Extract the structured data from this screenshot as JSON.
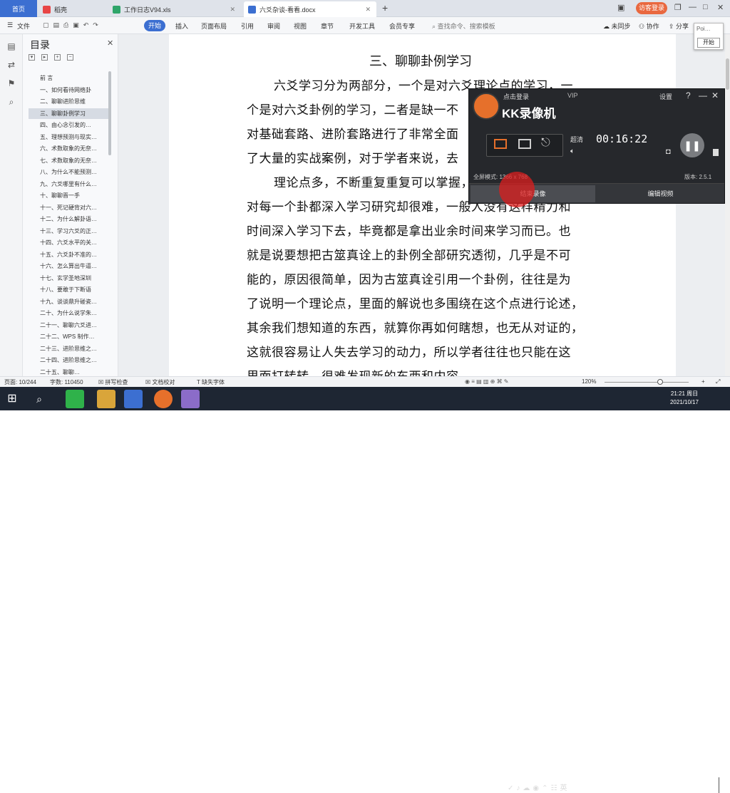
{
  "tabs": {
    "home": "首页",
    "t1": "稻壳",
    "t2": "工作日志V94.xls",
    "t3": "六爻杂谈-看看.docx"
  },
  "login": "访客登录",
  "toolbar": {
    "file": "文件",
    "start": "开始",
    "insert": "插入",
    "layout": "页面布局",
    "ref": "引用",
    "review": "审阅",
    "view": "视图",
    "chapter": "章节",
    "dev": "开发工具",
    "member": "会员专享",
    "search": "查找命令、搜索模板",
    "sync": "未同步",
    "collab": "协作",
    "share": "分享"
  },
  "toc": {
    "title": "目录",
    "items": [
      "前 言",
      "一、如何看待网络卦",
      "二、聊聊进阶思维",
      "三、聊聊卦例学习",
      "四、由心念引发的…",
      "五、理想预测与现实…",
      "六、术数取象的无奈…",
      "七、术数取象的无奈…",
      "八、为什么不能预测…",
      "九、六爻哪里有什么…",
      "十、聊聊晋一手",
      "十一、死记硬背对六…",
      "十二、为什么解卦语…",
      "十三、学习六爻的正…",
      "十四、六爻水平的关…",
      "十五、六爻卦不准的…",
      "十六、怎么算出牛逼…",
      "十七、玄学圣地深圳",
      "十八、要敢于下断语",
      "十九、谈谈鼎升碰瓷…",
      "二十、为什么说学朱…",
      "二十一、聊聊六爻进…",
      "二十二、WPS 制作…",
      "二十三、进阶思维之…",
      "二十四、进阶思维之…",
      "二十五、聊聊…"
    ]
  },
  "doc": {
    "title": "三、聊聊卦例学习",
    "lines": [
      "六爻学习分为两部分，一个是对六爻理论点的学习，一",
      "个是对六爻卦例的学习，二者是缺一不",
      "对基础套路、进阶套路进行了非常全面",
      "了大量的实战案例，对于学者来说，去",
      "理论点多，不断重复重复可以掌握，",
      "对每一个卦都深入学习研究却很难，一般人没有这样精力和",
      "时间深入学习下去，毕竟都是拿出业余时间来学习而已。也",
      "就是说要想把古筮真诠上的卦例全部研究透彻，几乎是不可",
      "能的，原因很简单，因为古筮真诠引用一个卦例，往往是为",
      "了说明一个理论点，里面的解说也多围绕在这个点进行论述，",
      "其余我们想知道的东西，就算你再如何瞎想，也无从对证的，",
      "这就很容易让人失去学习的动力，所以学者往往也只能在这",
      "里面打转转，很难发现新的东西和内容。"
    ]
  },
  "status": {
    "page": "页面: 10/244",
    "words": "字数: 110450",
    "spell": "拼写检查",
    "proof": "文档校对",
    "font": "缺失字体",
    "zoom": "120%"
  },
  "kk": {
    "login": "点击登录",
    "vip": "VIP",
    "settings": "设置",
    "name": "KK录像机",
    "quality": "超清",
    "time": "00:16:22",
    "mode": "全屏模式: 1366 x 768",
    "version": "版本: 2.5.1",
    "rec": "结束录像",
    "edit": "编辑视频"
  },
  "popup": {
    "top": "Poi…",
    "btn": "开始"
  },
  "clock": {
    "time": "21:21 周日",
    "date": "2021/10/17"
  },
  "colors": {
    "accent": "#3c6fd1",
    "kk_orange": "#e6702b",
    "taskbar": "#1e2633"
  }
}
